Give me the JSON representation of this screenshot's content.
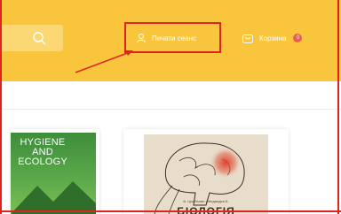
{
  "header": {
    "background_color": "#f9c53c",
    "search": {
      "icon": "search-icon"
    },
    "account": {
      "label": "Печати сеанс",
      "icon": "user-icon"
    },
    "cart": {
      "label": "Корзина",
      "icon": "cart-icon",
      "badge": "0"
    }
  },
  "annotation": {
    "color": "#e0231f",
    "arrow": "arrow-pointing-to-account"
  },
  "books": [
    {
      "cover_title": "HYGIENE AND ECOLOGY",
      "cover_title_lines": [
        "HYGIENE",
        "AND",
        "ECOLOGY"
      ],
      "cover_color": "#4a9a40"
    },
    {
      "authors": "В. Цимбалин • Медведев Б.",
      "cover_title": "БІОЛОГІЯ",
      "cover_color": "#e8dccb"
    }
  ]
}
